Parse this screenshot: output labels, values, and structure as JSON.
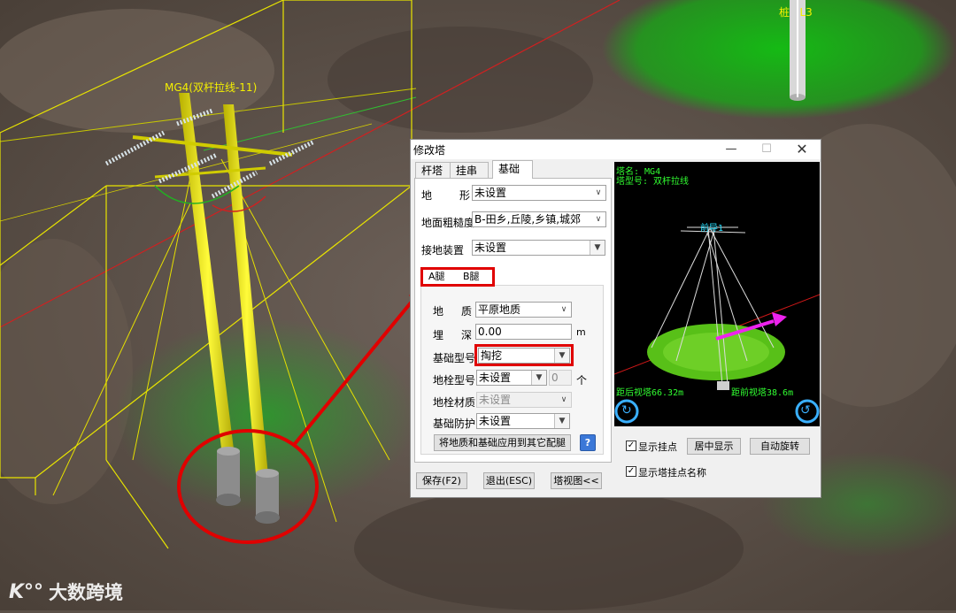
{
  "scene": {
    "tower_label": "MG4(双杆拉线-11)",
    "pile_label": "桩",
    "pile_label_suffix": "L3",
    "watermark": "大数跨境",
    "watermark_logo": "K°°"
  },
  "dialog": {
    "title": "修改塔",
    "min_symbol": "—",
    "max_symbol": "☐",
    "close_symbol": "✕",
    "tabs": [
      "杆塔",
      "挂串",
      "基础"
    ],
    "active_tab": "基础",
    "terrain": {
      "label_a": "地",
      "label_b": "形",
      "value": "未设置"
    },
    "roughness": {
      "label": "地面粗糙度",
      "value": "B-田乡,丘陵,乡镇,城郊"
    },
    "grounding": {
      "label": "接地装置",
      "value": "未设置"
    },
    "leg_tabs": [
      "A腿",
      "B腿"
    ],
    "geology": {
      "label_a": "地",
      "label_b": "质",
      "value": "平原地质"
    },
    "depth": {
      "label_a": "埋",
      "label_b": "深",
      "value": "0.00",
      "unit": "m"
    },
    "foundation_type": {
      "label": "基础型号",
      "value": "掏挖"
    },
    "anchor_type": {
      "label": "地栓型号",
      "value": "未设置",
      "count": "0",
      "unit": "个"
    },
    "anchor_material": {
      "label": "地栓材质",
      "value": "未设置"
    },
    "foundation_protection": {
      "label": "基础防护",
      "value": "未设置"
    },
    "apply_button": "将地质和基础应用到其它配腿",
    "help_symbol": "?",
    "save_button": "保存(F2)",
    "exit_button": "退出(ESC)",
    "tower_view_button": "塔视图<<",
    "preview": {
      "tower_name": "塔名: MG4",
      "tower_type": "塔型号: 双杆拉线",
      "front_label": "前导1",
      "back_distance": "距后视塔66.32m",
      "front_distance": "距前视塔38.6m"
    },
    "show_hang_points": {
      "label": "显示挂点",
      "checked": true
    },
    "center_display": "居中显示",
    "auto_rotate": "自动旋转",
    "show_hang_names": {
      "label": "显示塔挂点名称",
      "checked": true
    }
  },
  "colors": {
    "highlight": "#e00000",
    "tower_yellow": "#f4f000",
    "preview_text": "#31ff31"
  }
}
